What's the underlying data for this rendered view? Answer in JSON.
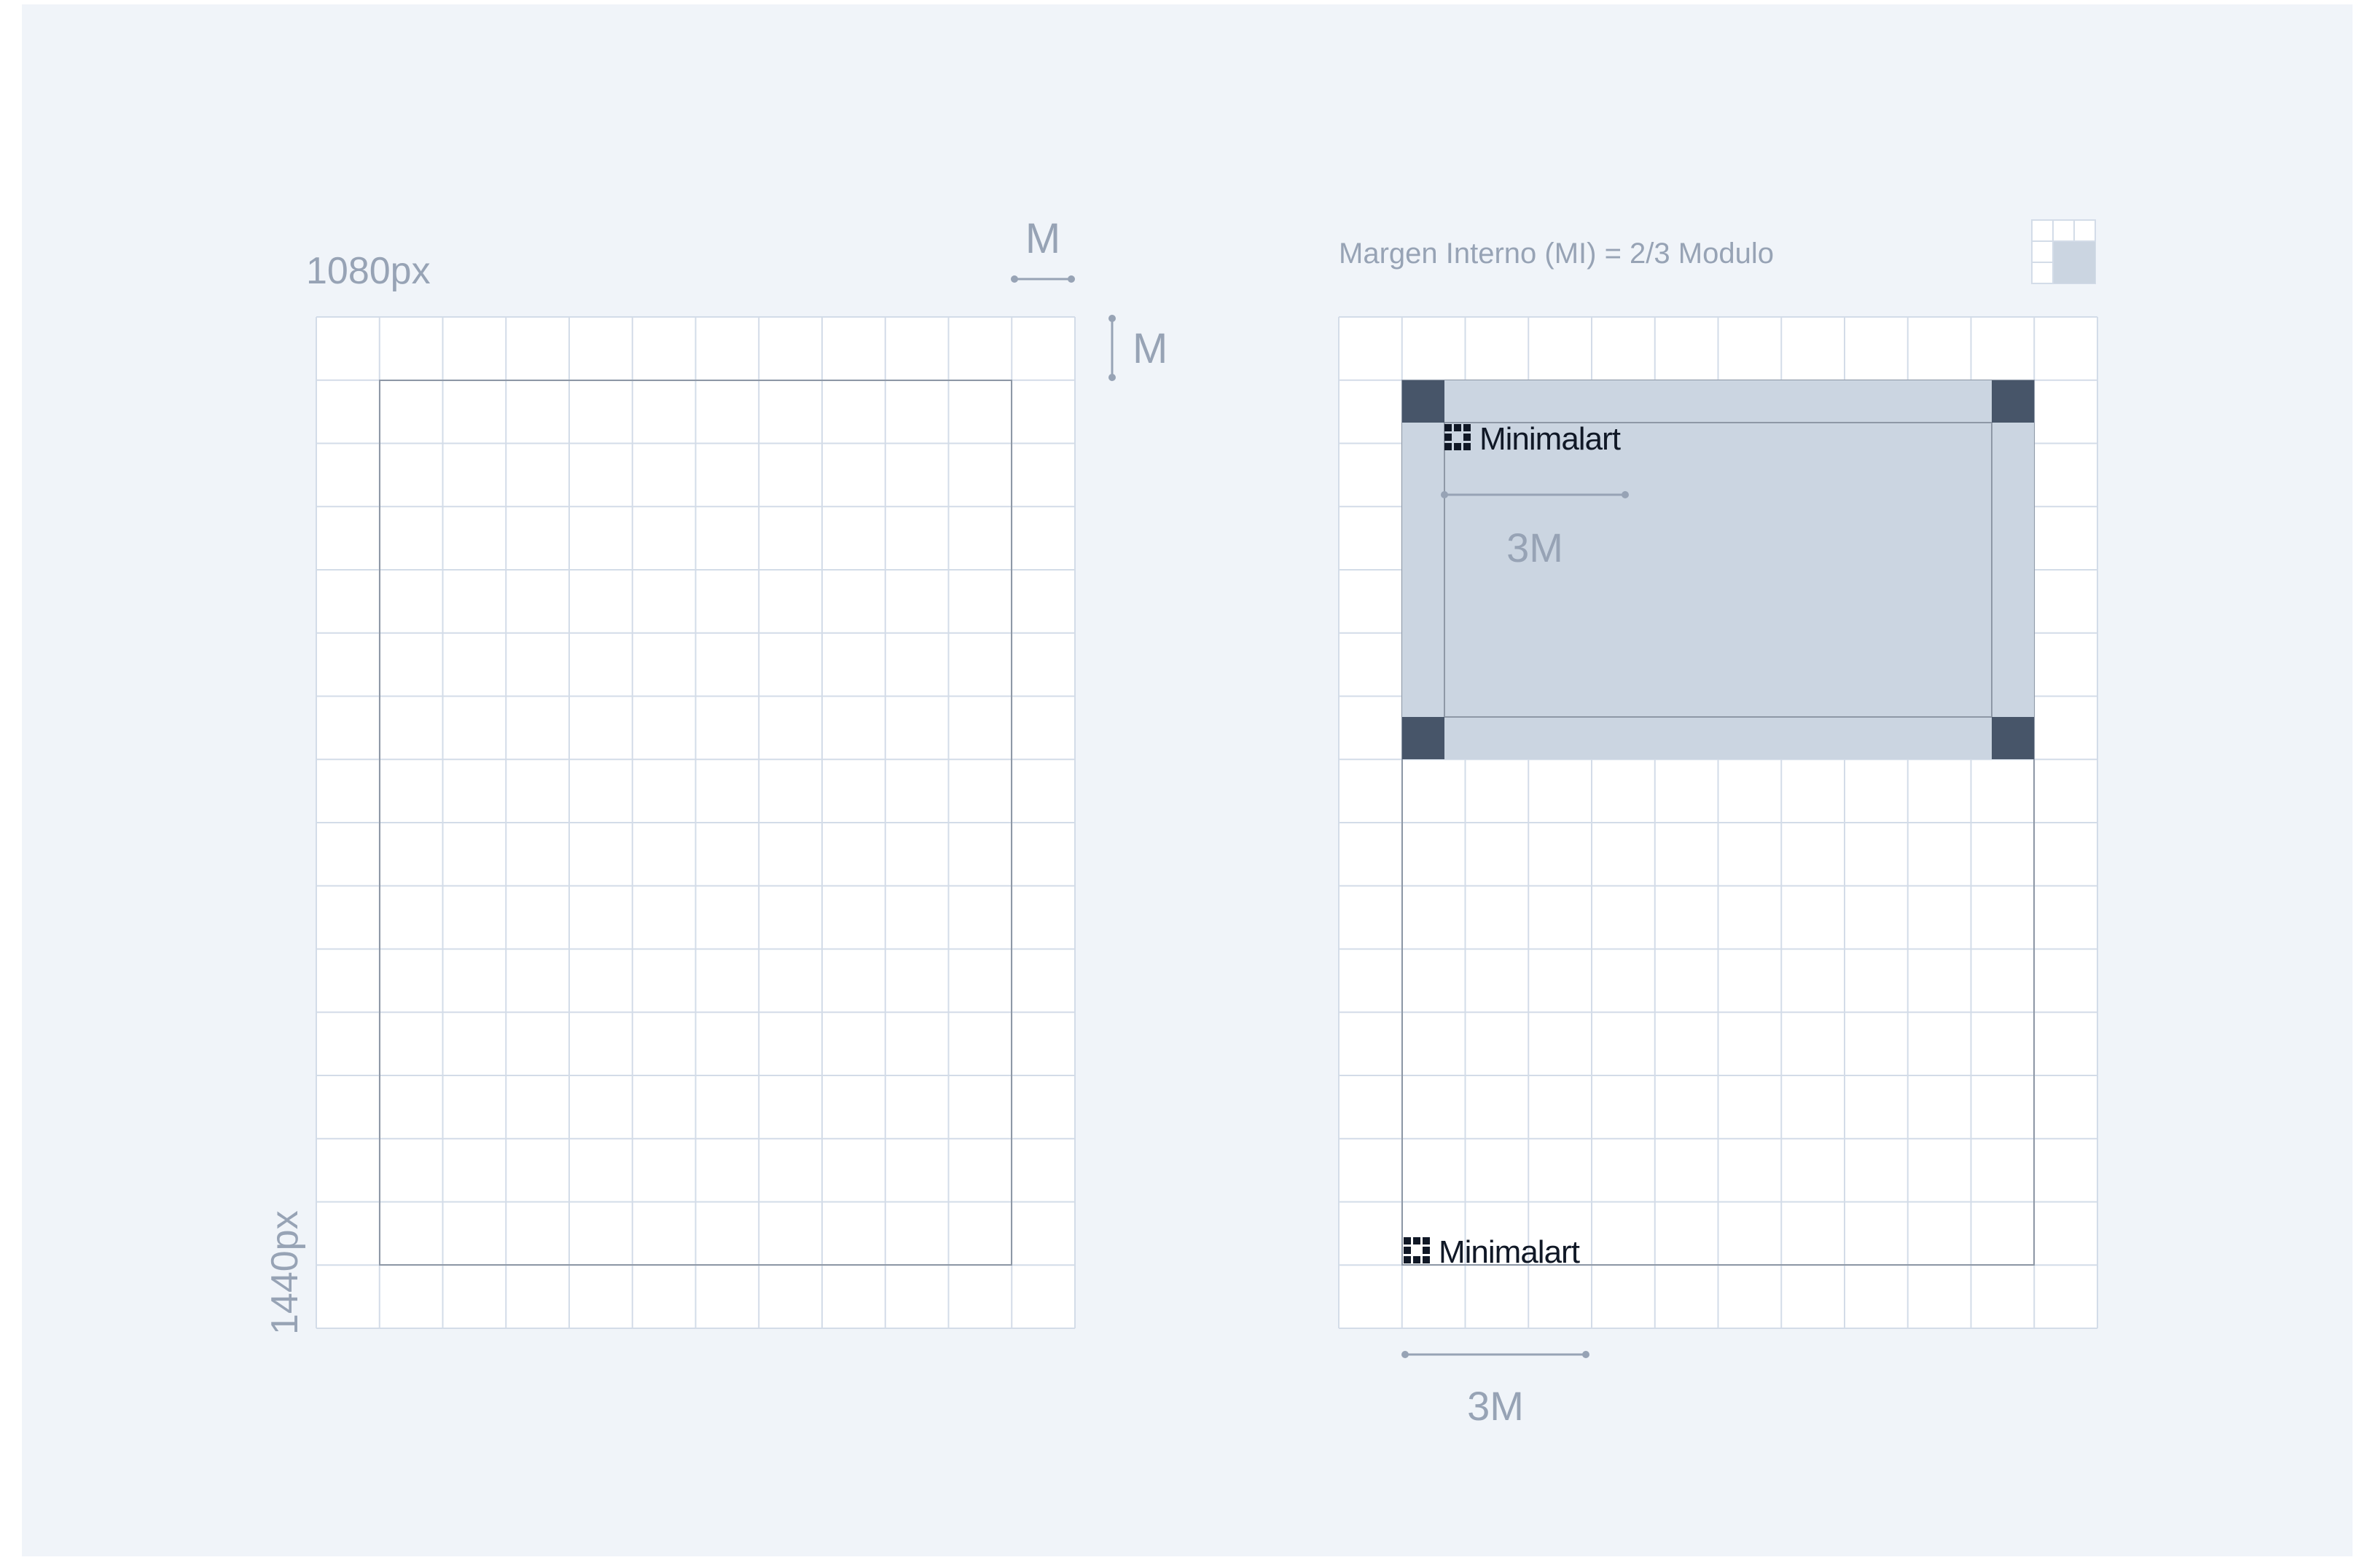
{
  "colors": {
    "background": "#f0f4f9",
    "page": "#ffffff",
    "grid_line": "#d3dce8",
    "frame_line": "#8e98a6",
    "highlight_fill": "#cbd5e1",
    "corner_fill": "#475569",
    "dimension": "#97a3b5",
    "logo": "#101826"
  },
  "grid": {
    "columns": 12,
    "rows": 16
  },
  "left_panel": {
    "width_label": "1080px",
    "height_label": "1440px",
    "module_label_horizontal": "M",
    "module_label_vertical": "M"
  },
  "right_panel": {
    "caption": "Margen Interno (MI) = 2/3 Modulo",
    "logo_text_top": "Minimalart",
    "logo_text_bottom": "Minimalart",
    "dimension_inner": "3M",
    "dimension_bottom": "3M",
    "legend_icon": "mini-grid-legend-icon"
  }
}
